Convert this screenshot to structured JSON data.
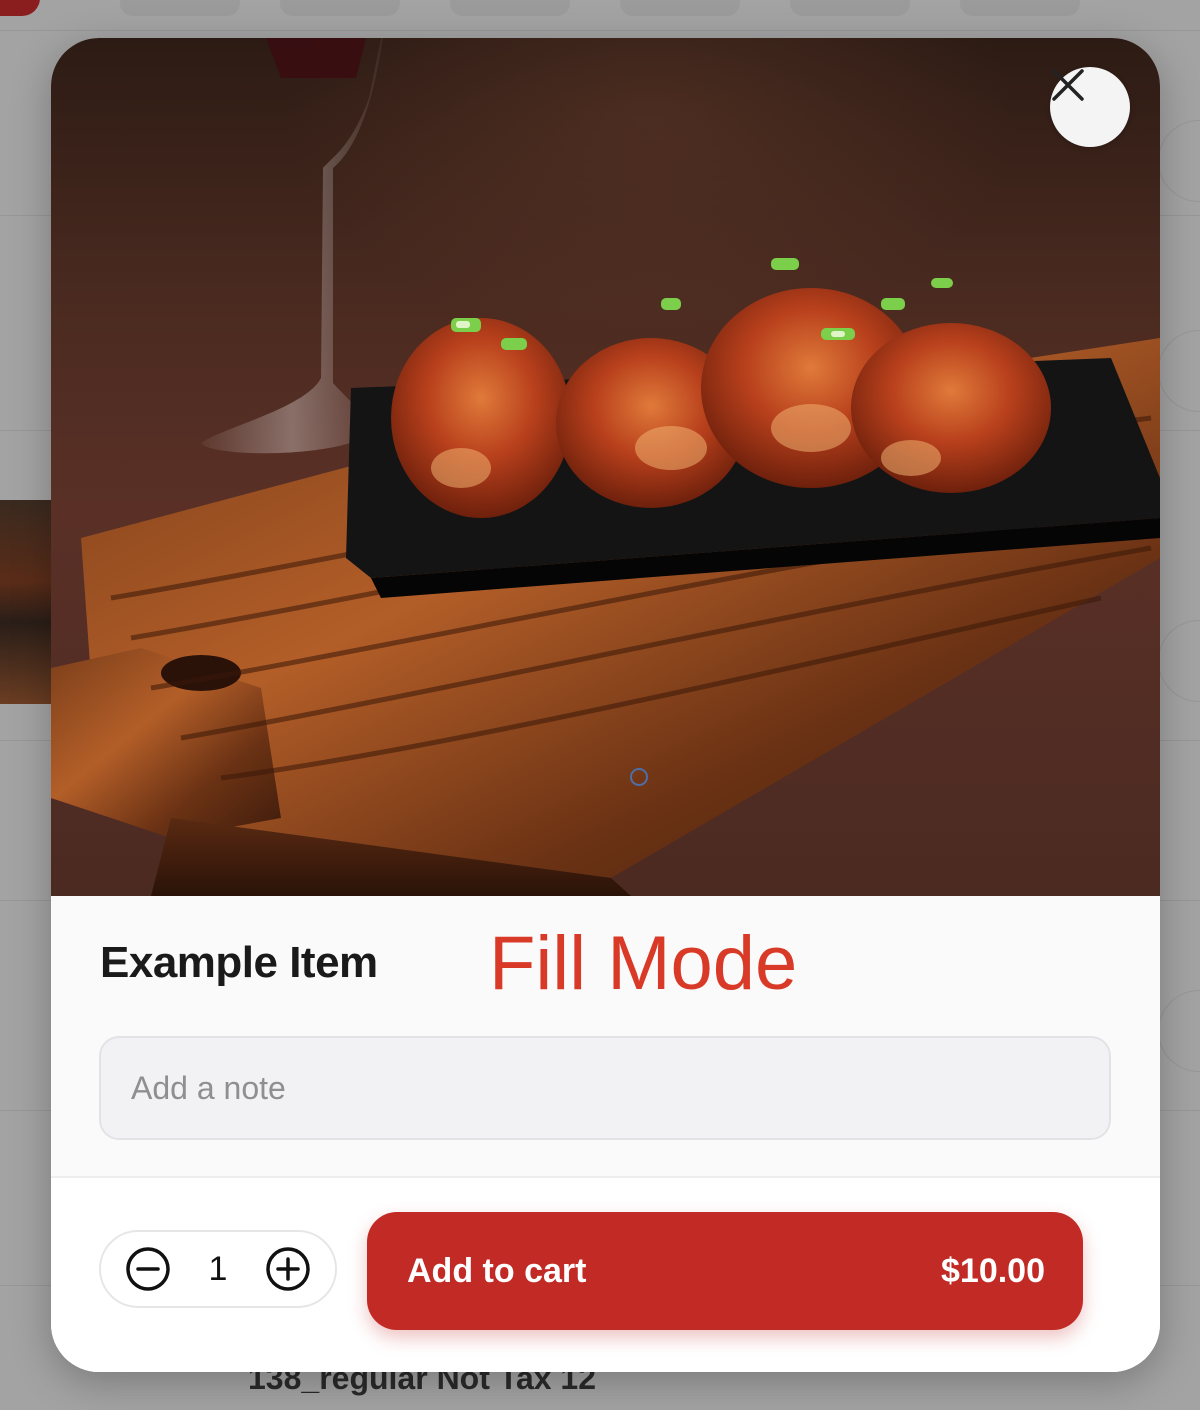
{
  "background": {
    "behind_text": "138_regular Not Tax 12"
  },
  "modal": {
    "close_icon": "close-icon",
    "item": {
      "title": "Example Item",
      "image_alt": "Fried chicken wings on a wooden board"
    },
    "overlay_label": "Fill Mode",
    "note": {
      "placeholder": "Add a note",
      "value": ""
    },
    "quantity": {
      "value": "1",
      "decrement_icon": "minus-circle-icon",
      "increment_icon": "plus-circle-icon"
    },
    "add_to_cart": {
      "label": "Add to cart",
      "price": "$10.00"
    }
  },
  "colors": {
    "accent": "#c22a26",
    "overlay_text": "#d93a27",
    "title": "#1a1a1a",
    "input_bg": "#f2f2f4"
  }
}
